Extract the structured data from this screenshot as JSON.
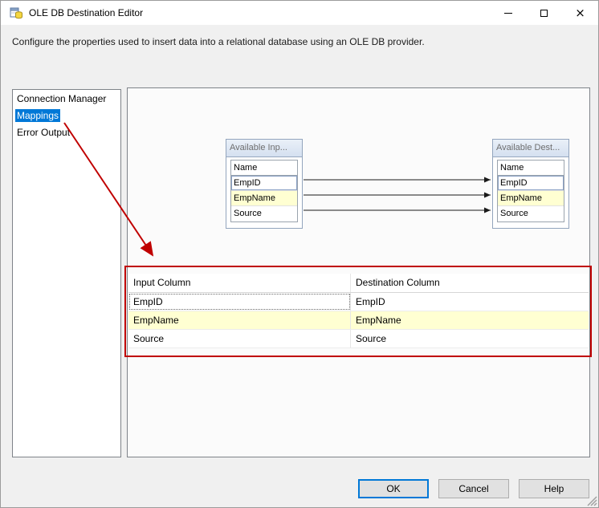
{
  "window": {
    "title": "OLE DB Destination Editor",
    "description": "Configure the properties used to insert data into a relational database using an OLE DB provider."
  },
  "sidebar": {
    "items": [
      {
        "label": "Connection Manager"
      },
      {
        "label": "Mappings"
      },
      {
        "label": "Error Output"
      }
    ],
    "selected": "Mappings"
  },
  "diagram": {
    "input_table": {
      "title": "Available Inp...",
      "header": "Name",
      "rows": [
        "EmpID",
        "EmpName",
        "Source"
      ]
    },
    "destination_table": {
      "title": "Available Dest...",
      "header": "Name",
      "rows": [
        "EmpID",
        "EmpName",
        "Source"
      ]
    },
    "mappings": [
      {
        "from": "EmpID",
        "to": "EmpID"
      },
      {
        "from": "EmpName",
        "to": "EmpName"
      },
      {
        "from": "Source",
        "to": "Source"
      }
    ]
  },
  "grid": {
    "columns": [
      "Input Column",
      "Destination Column"
    ],
    "rows": [
      {
        "input": "EmpID",
        "destination": "EmpID"
      },
      {
        "input": "EmpName",
        "destination": "EmpName"
      },
      {
        "input": "Source",
        "destination": "Source"
      }
    ]
  },
  "buttons": {
    "ok": "OK",
    "cancel": "Cancel",
    "help": "Help"
  },
  "icons": {
    "app": "database-icon",
    "minimize": "minimize-icon",
    "maximize": "maximize-icon",
    "close": "close-icon"
  },
  "colors": {
    "selection_blue": "#0078d7",
    "row_highlight_yellow": "#ffffd2",
    "annotation_red": "#c00000"
  }
}
